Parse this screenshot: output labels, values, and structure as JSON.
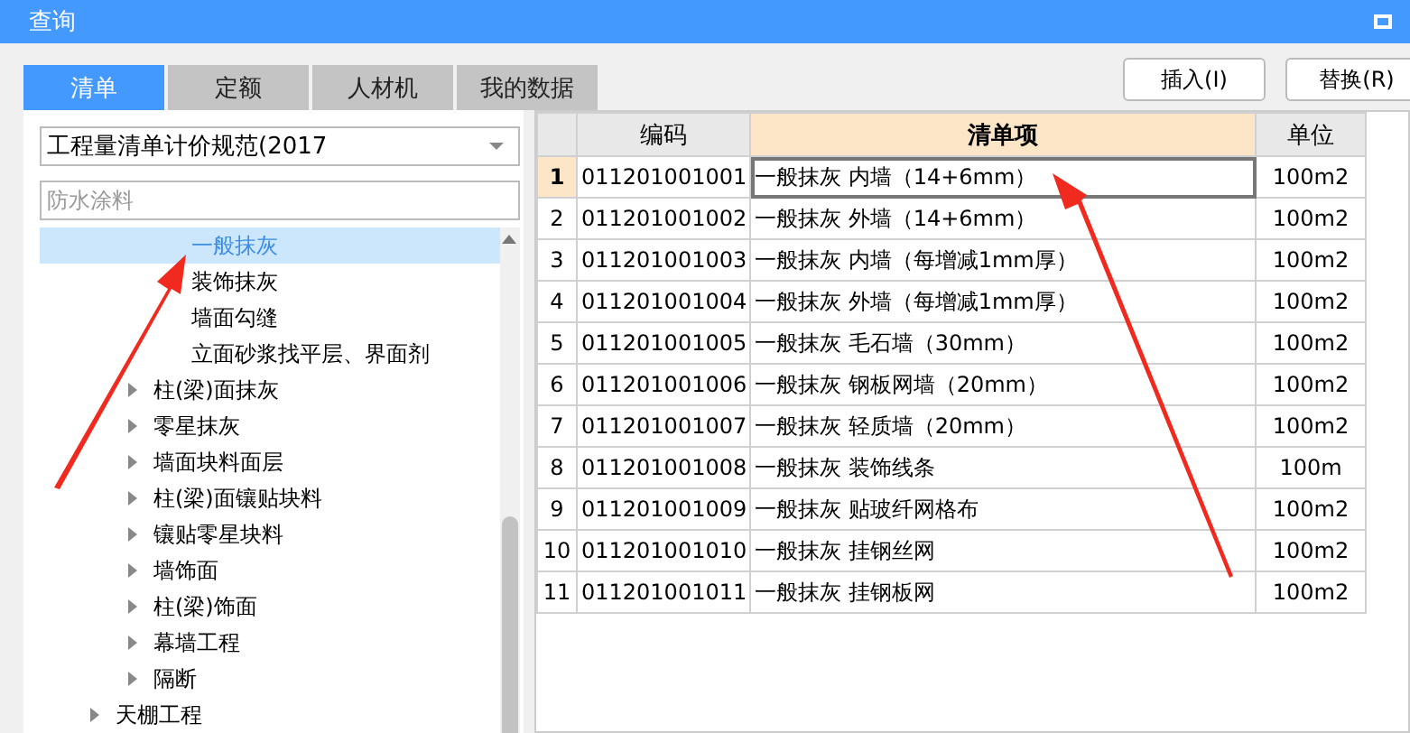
{
  "window": {
    "title": "查询"
  },
  "tabs": [
    {
      "label": "清单",
      "selected": true
    },
    {
      "label": "定额",
      "selected": false
    },
    {
      "label": "人材机",
      "selected": false
    },
    {
      "label": "我的数据",
      "selected": false
    }
  ],
  "buttons": [
    "插入(I)",
    "替换(R)"
  ],
  "dropdown": {
    "value": "工程量清单计价规范(2017"
  },
  "search": {
    "placeholder": "防水涂料"
  },
  "tree": [
    {
      "children": [
        {
          "children": [
            {
              "label": "一般抹灰",
              "selected": true
            },
            {
              "label": "装饰抹灰",
              "selected": false
            },
            {
              "label": "墙面勾缝",
              "selected": false
            },
            {
              "label": "立面砂浆找平层、界面剂",
              "selected": false
            }
          ]
        },
        {
          "label": "柱(梁)面抹灰",
          "expanded": false,
          "selected": false
        },
        {
          "label": "零星抹灰",
          "expanded": false,
          "selected": false
        },
        {
          "label": "墙面块料面层",
          "expanded": false,
          "selected": false
        },
        {
          "label": "柱(梁)面镶贴块料",
          "expanded": false,
          "selected": false
        },
        {
          "label": "镶贴零星块料",
          "expanded": false,
          "selected": false
        },
        {
          "label": "墙饰面",
          "expanded": false,
          "selected": false
        },
        {
          "label": "柱(梁)饰面",
          "expanded": false,
          "selected": false
        },
        {
          "label": "幕墙工程",
          "expanded": false,
          "selected": false
        },
        {
          "label": "隔断",
          "expanded": false,
          "selected": false
        }
      ]
    },
    {
      "label": "天棚工程",
      "expanded": false,
      "selected": false
    }
  ],
  "table": {
    "columns": [
      {
        "label": "编码",
        "selected": false
      },
      {
        "label": "清单项",
        "selected": true
      },
      {
        "label": "单位",
        "selected": false
      }
    ],
    "rows": [
      {
        "index": "1",
        "code": "011201001001",
        "item": "一般抹灰 内墙（14+6mm）",
        "unit": "100m2",
        "selected": true
      },
      {
        "index": "2",
        "code": "011201001002",
        "item": "一般抹灰 外墙（14+6mm）",
        "unit": "100m2",
        "selected": false
      },
      {
        "index": "3",
        "code": "011201001003",
        "item": "一般抹灰 内墙（每增减1mm厚）",
        "unit": "100m2",
        "selected": false
      },
      {
        "index": "4",
        "code": "011201001004",
        "item": "一般抹灰 外墙（每增减1mm厚）",
        "unit": "100m2",
        "selected": false
      },
      {
        "index": "5",
        "code": "011201001005",
        "item": "一般抹灰 毛石墙（30mm）",
        "unit": "100m2",
        "selected": false
      },
      {
        "index": "6",
        "code": "011201001006",
        "item": "一般抹灰 钢板网墙（20mm）",
        "unit": "100m2",
        "selected": false
      },
      {
        "index": "7",
        "code": "011201001007",
        "item": "一般抹灰 轻质墙（20mm）",
        "unit": "100m2",
        "selected": false
      },
      {
        "index": "8",
        "code": "011201001008",
        "item": "一般抹灰 装饰线条",
        "unit": "100m",
        "selected": false
      },
      {
        "index": "9",
        "code": "011201001009",
        "item": "一般抹灰 贴玻纤网格布",
        "unit": "100m2",
        "selected": false
      },
      {
        "index": "10",
        "code": "011201001010",
        "item": "一般抹灰 挂钢丝网",
        "unit": "100m2",
        "selected": false
      },
      {
        "index": "11",
        "code": "011201001011",
        "item": "一般抹灰 挂钢板网",
        "unit": "100m2",
        "selected": false
      }
    ]
  }
}
